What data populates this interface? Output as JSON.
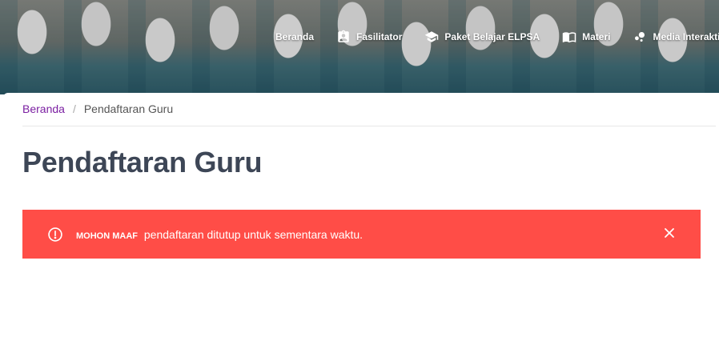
{
  "colors": {
    "accent_link": "#7b1fa2",
    "title": "#3d4656",
    "alert_bg": "#ff4d47",
    "alert_text": "#ffffff"
  },
  "nav": {
    "items": [
      {
        "label": "Beranda",
        "icon": null
      },
      {
        "label": "Fasilitator",
        "icon": "id-badge-icon"
      },
      {
        "label": "Paket Belajar ELPSA",
        "icon": "graduation-cap-icon"
      },
      {
        "label": "Materi",
        "icon": "open-book-icon"
      },
      {
        "label": "Media Interaktif",
        "icon": "bubbles-icon"
      }
    ]
  },
  "breadcrumb": {
    "home": "Beranda",
    "separator": "/",
    "current": "Pendaftaran Guru"
  },
  "page": {
    "title": "Pendaftaran Guru"
  },
  "alert": {
    "icon": "exclamation-circle-icon",
    "strong": "MOHON MAAF",
    "message": "pendaftaran ditutup untuk sementara waktu.",
    "close_icon": "close-icon"
  }
}
